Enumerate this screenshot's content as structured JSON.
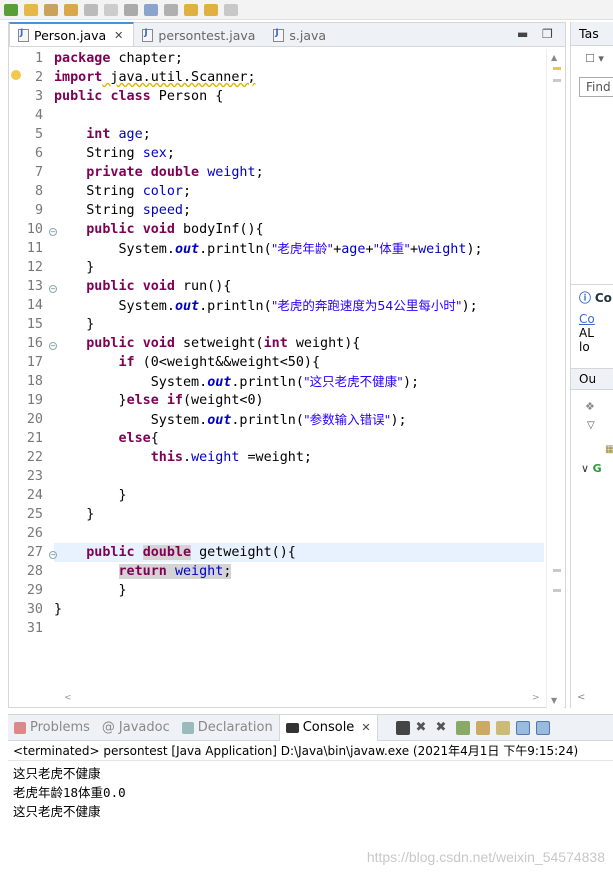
{
  "editor": {
    "tabs": [
      {
        "label": "Person.java",
        "active": true
      },
      {
        "label": "persontest.java",
        "active": false
      },
      {
        "label": "s.java",
        "active": false
      }
    ],
    "line_numbers": [
      "1",
      "2",
      "3",
      "4",
      "5",
      "6",
      "7",
      "8",
      "9",
      "10",
      "11",
      "12",
      "13",
      "14",
      "15",
      "16",
      "17",
      "18",
      "19",
      "20",
      "21",
      "22",
      "23",
      "24",
      "25",
      "26",
      "27",
      "28",
      "29",
      "30",
      "31"
    ],
    "code": {
      "l1_kw": "package",
      "l1_rest": " chapter;",
      "l2_kw": "import",
      "l2_rest": " java.util.Scanner;",
      "l3_kw1": "public",
      "l3_kw2": "class",
      "l3_rest": " Person {",
      "l5_kw": "int",
      "l5_fld": "age",
      "l5_end": ";",
      "l6_type": "String ",
      "l6_fld": "sex",
      "l6_end": ";",
      "l7_kw1": "private",
      "l7_kw2": "double",
      "l7_fld": "weight",
      "l7_end": ";",
      "l8_type": "String ",
      "l8_fld": "color",
      "l8_end": ";",
      "l9_type": "String ",
      "l9_fld": "speed",
      "l9_end": ";",
      "l10_kw1": "public",
      "l10_kw2": "void",
      "l10_rest": " bodyInf(){",
      "l11_a": "System.",
      "l11_out": "out",
      "l11_b": ".println(",
      "l11_s1": "\"老虎年龄\"",
      "l11_c": "+",
      "l11_f1": "age",
      "l11_d": "+",
      "l11_s2": "\"体重\"",
      "l11_e": "+",
      "l11_f2": "weight",
      "l11_g": ");",
      "l12": "}",
      "l13_kw1": "public",
      "l13_kw2": "void",
      "l13_rest": " run(){",
      "l14_a": "System.",
      "l14_out": "out",
      "l14_b": ".println(",
      "l14_s": "\"老虎的奔跑速度为54公里每小时\"",
      "l14_c": ");",
      "l15": "}",
      "l16_kw1": "public",
      "l16_kw2": "void",
      "l16_a": " setweight(",
      "l16_kw3": "int",
      "l16_b": " weight){",
      "l17_kw": "if",
      "l17_a": " (0<weight&&weight<50){",
      "l18_a": "System.",
      "l18_out": "out",
      "l18_b": ".println(",
      "l18_s": "\"这只老虎不健康\"",
      "l18_c": ");",
      "l19_a": "}",
      "l19_kw1": "else",
      "l19_kw2": "if",
      "l19_b": "(weight<0)",
      "l20_a": "System.",
      "l20_out": "out",
      "l20_b": ".println(",
      "l20_s": "\"参数输入错误\"",
      "l20_c": ");",
      "l21_kw": "else",
      "l21_a": "{",
      "l22_kw": "this",
      "l22_a": ".",
      "l22_fld": "weight",
      "l22_b": " =weight;",
      "l24": "}",
      "l25": "}",
      "l27_kw1": "public",
      "l27_kw2": "double",
      "l27_rest": " getweight(){",
      "l28_kw": "return",
      "l28_fld": "weight",
      "l28_end": ";",
      "l29": "}",
      "l30": "}"
    }
  },
  "right_pane": {
    "tasks_tab": "Tas",
    "find_placeholder": "Find",
    "info_label": "Co",
    "info_link": "Co",
    "info_line1": "AL",
    "info_line2": "lo",
    "outline_tab": "Ou"
  },
  "console": {
    "tabs": [
      "Problems",
      "Javadoc",
      "Declaration",
      "Console"
    ],
    "status": "<terminated> persontest [Java Application] D:\\Java\\bin\\javaw.exe (2021年4月1日 下午9:15:24)",
    "output": [
      "这只老虎不健康",
      "老虎年龄18体重0.0",
      "这只老虎不健康"
    ]
  },
  "watermark": "https://blog.csdn.net/weixin_54574838",
  "colors": {
    "keyword": "#7f0055",
    "field": "#0000c0",
    "string": "#2a00ff",
    "line_highlight": "#e8f2fe",
    "change_bar": "#2fa8a0"
  }
}
